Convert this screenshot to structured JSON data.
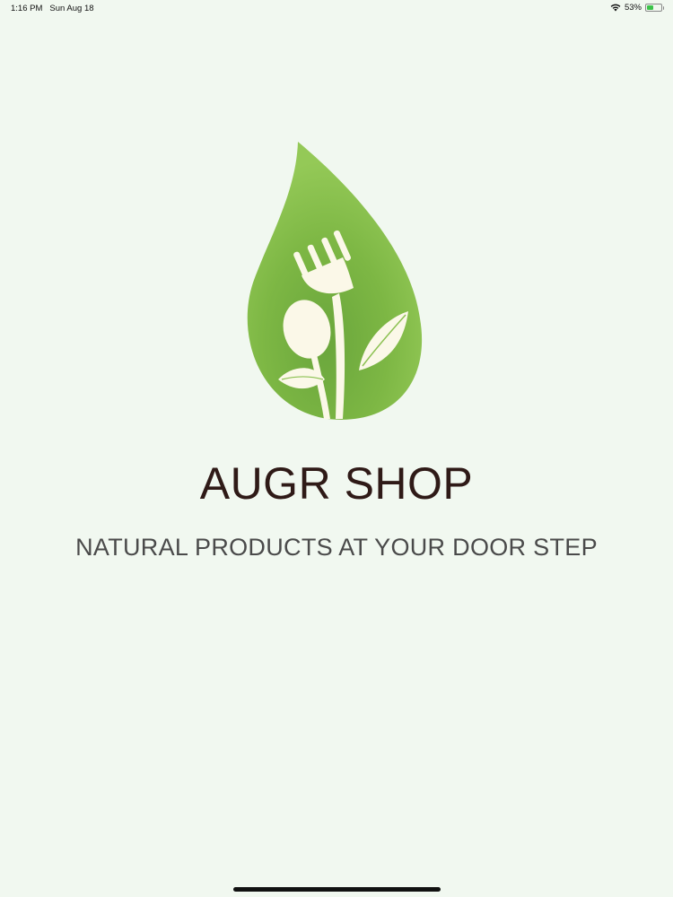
{
  "status_bar": {
    "time": "1:16 PM",
    "date": "Sun Aug 18",
    "battery_percent": "53%",
    "battery_level": 0.53,
    "icons": [
      "wifi-icon",
      "battery-icon"
    ]
  },
  "splash": {
    "title": "AUGR SHOP",
    "tagline": "NATURAL PRODUCTS AT YOUR DOOR STEP",
    "logo": "leaf-fork-spoon-logo"
  },
  "colors": {
    "background": "#f1f8f0",
    "leaf_green": "#8cc152",
    "title_color": "#2f1a17",
    "utensil_cream": "#fbf8e8"
  }
}
